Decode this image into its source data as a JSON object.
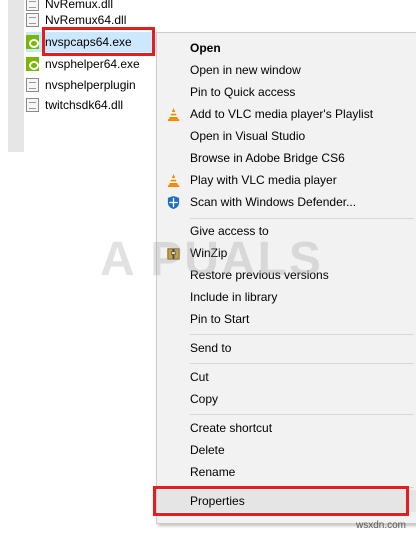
{
  "files": [
    {
      "name": "NvRemux.dll",
      "icon": "dll-file-icon"
    },
    {
      "name": "NvRemux64.dll",
      "icon": "dll-file-icon"
    },
    {
      "name": "nvspcaps64.exe",
      "icon": "nvidia-exe-icon",
      "selected": true
    },
    {
      "name": "nvsphelper64.exe",
      "icon": "nvidia-exe-icon"
    },
    {
      "name": "nvsphelperplugin",
      "icon": "dll-file-icon"
    },
    {
      "name": "twitchsdk64.dll",
      "icon": "dll-file-icon"
    }
  ],
  "context_menu": {
    "open": "Open",
    "open_new_window": "Open in new window",
    "pin_quick_access": "Pin to Quick access",
    "add_vlc_playlist": "Add to VLC media player's Playlist",
    "open_visual_studio": "Open in Visual Studio",
    "browse_bridge": "Browse in Adobe Bridge CS6",
    "play_vlc": "Play with VLC media player",
    "scan_defender": "Scan with Windows Defender...",
    "give_access": "Give access to",
    "winzip": "WinZip",
    "restore_versions": "Restore previous versions",
    "include_library": "Include in library",
    "pin_start": "Pin to Start",
    "send_to": "Send to",
    "cut": "Cut",
    "copy": "Copy",
    "create_shortcut": "Create shortcut",
    "delete": "Delete",
    "rename": "Rename",
    "properties": "Properties"
  },
  "watermark": "A PUALS",
  "source": "wsxdn.com",
  "colors": {
    "highlight_red": "#e41e1e",
    "nvidia_green": "#76b900",
    "menu_bg": "#f2f2f2",
    "selection_blue": "#cce8ff",
    "vlc_orange": "#f08a00",
    "defender_blue": "#1f6fc5"
  }
}
